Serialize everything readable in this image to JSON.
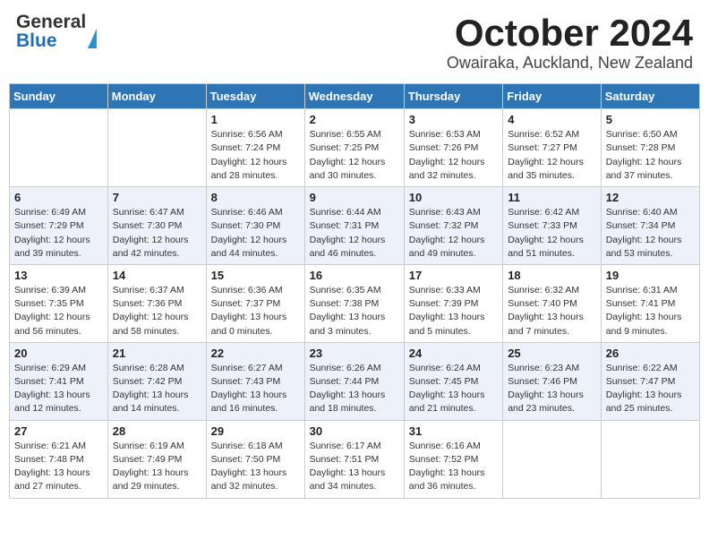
{
  "header": {
    "logo_general": "General",
    "logo_blue": "Blue",
    "month_title": "October 2024",
    "location": "Owairaka, Auckland, New Zealand"
  },
  "days_of_week": [
    "Sunday",
    "Monday",
    "Tuesday",
    "Wednesday",
    "Thursday",
    "Friday",
    "Saturday"
  ],
  "weeks": [
    [
      {
        "day": "",
        "info": ""
      },
      {
        "day": "",
        "info": ""
      },
      {
        "day": "1",
        "info": "Sunrise: 6:56 AM\nSunset: 7:24 PM\nDaylight: 12 hours\nand 28 minutes."
      },
      {
        "day": "2",
        "info": "Sunrise: 6:55 AM\nSunset: 7:25 PM\nDaylight: 12 hours\nand 30 minutes."
      },
      {
        "day": "3",
        "info": "Sunrise: 6:53 AM\nSunset: 7:26 PM\nDaylight: 12 hours\nand 32 minutes."
      },
      {
        "day": "4",
        "info": "Sunrise: 6:52 AM\nSunset: 7:27 PM\nDaylight: 12 hours\nand 35 minutes."
      },
      {
        "day": "5",
        "info": "Sunrise: 6:50 AM\nSunset: 7:28 PM\nDaylight: 12 hours\nand 37 minutes."
      }
    ],
    [
      {
        "day": "6",
        "info": "Sunrise: 6:49 AM\nSunset: 7:29 PM\nDaylight: 12 hours\nand 39 minutes."
      },
      {
        "day": "7",
        "info": "Sunrise: 6:47 AM\nSunset: 7:30 PM\nDaylight: 12 hours\nand 42 minutes."
      },
      {
        "day": "8",
        "info": "Sunrise: 6:46 AM\nSunset: 7:30 PM\nDaylight: 12 hours\nand 44 minutes."
      },
      {
        "day": "9",
        "info": "Sunrise: 6:44 AM\nSunset: 7:31 PM\nDaylight: 12 hours\nand 46 minutes."
      },
      {
        "day": "10",
        "info": "Sunrise: 6:43 AM\nSunset: 7:32 PM\nDaylight: 12 hours\nand 49 minutes."
      },
      {
        "day": "11",
        "info": "Sunrise: 6:42 AM\nSunset: 7:33 PM\nDaylight: 12 hours\nand 51 minutes."
      },
      {
        "day": "12",
        "info": "Sunrise: 6:40 AM\nSunset: 7:34 PM\nDaylight: 12 hours\nand 53 minutes."
      }
    ],
    [
      {
        "day": "13",
        "info": "Sunrise: 6:39 AM\nSunset: 7:35 PM\nDaylight: 12 hours\nand 56 minutes."
      },
      {
        "day": "14",
        "info": "Sunrise: 6:37 AM\nSunset: 7:36 PM\nDaylight: 12 hours\nand 58 minutes."
      },
      {
        "day": "15",
        "info": "Sunrise: 6:36 AM\nSunset: 7:37 PM\nDaylight: 13 hours\nand 0 minutes."
      },
      {
        "day": "16",
        "info": "Sunrise: 6:35 AM\nSunset: 7:38 PM\nDaylight: 13 hours\nand 3 minutes."
      },
      {
        "day": "17",
        "info": "Sunrise: 6:33 AM\nSunset: 7:39 PM\nDaylight: 13 hours\nand 5 minutes."
      },
      {
        "day": "18",
        "info": "Sunrise: 6:32 AM\nSunset: 7:40 PM\nDaylight: 13 hours\nand 7 minutes."
      },
      {
        "day": "19",
        "info": "Sunrise: 6:31 AM\nSunset: 7:41 PM\nDaylight: 13 hours\nand 9 minutes."
      }
    ],
    [
      {
        "day": "20",
        "info": "Sunrise: 6:29 AM\nSunset: 7:41 PM\nDaylight: 13 hours\nand 12 minutes."
      },
      {
        "day": "21",
        "info": "Sunrise: 6:28 AM\nSunset: 7:42 PM\nDaylight: 13 hours\nand 14 minutes."
      },
      {
        "day": "22",
        "info": "Sunrise: 6:27 AM\nSunset: 7:43 PM\nDaylight: 13 hours\nand 16 minutes."
      },
      {
        "day": "23",
        "info": "Sunrise: 6:26 AM\nSunset: 7:44 PM\nDaylight: 13 hours\nand 18 minutes."
      },
      {
        "day": "24",
        "info": "Sunrise: 6:24 AM\nSunset: 7:45 PM\nDaylight: 13 hours\nand 21 minutes."
      },
      {
        "day": "25",
        "info": "Sunrise: 6:23 AM\nSunset: 7:46 PM\nDaylight: 13 hours\nand 23 minutes."
      },
      {
        "day": "26",
        "info": "Sunrise: 6:22 AM\nSunset: 7:47 PM\nDaylight: 13 hours\nand 25 minutes."
      }
    ],
    [
      {
        "day": "27",
        "info": "Sunrise: 6:21 AM\nSunset: 7:48 PM\nDaylight: 13 hours\nand 27 minutes."
      },
      {
        "day": "28",
        "info": "Sunrise: 6:19 AM\nSunset: 7:49 PM\nDaylight: 13 hours\nand 29 minutes."
      },
      {
        "day": "29",
        "info": "Sunrise: 6:18 AM\nSunset: 7:50 PM\nDaylight: 13 hours\nand 32 minutes."
      },
      {
        "day": "30",
        "info": "Sunrise: 6:17 AM\nSunset: 7:51 PM\nDaylight: 13 hours\nand 34 minutes."
      },
      {
        "day": "31",
        "info": "Sunrise: 6:16 AM\nSunset: 7:52 PM\nDaylight: 13 hours\nand 36 minutes."
      },
      {
        "day": "",
        "info": ""
      },
      {
        "day": "",
        "info": ""
      }
    ]
  ]
}
